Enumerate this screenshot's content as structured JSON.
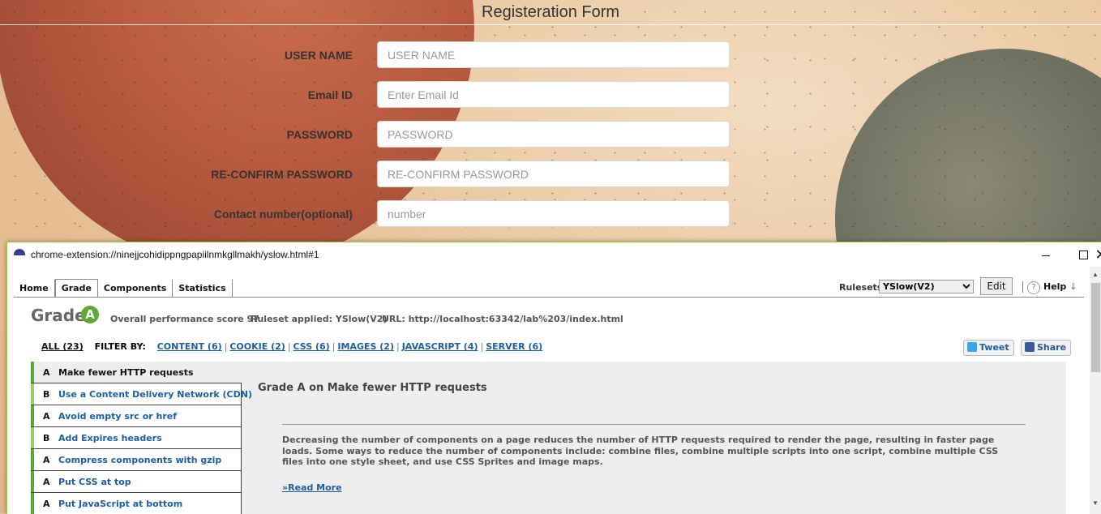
{
  "form": {
    "title": "Registeration Form",
    "fields": [
      {
        "label": "USER NAME",
        "placeholder": "USER NAME"
      },
      {
        "label": "Email ID",
        "placeholder": "Enter Email Id"
      },
      {
        "label": "PASSWORD",
        "placeholder": "PASSWORD"
      },
      {
        "label": "RE-CONFIRM PASSWORD",
        "placeholder": "RE-CONFIRM PASSWORD"
      },
      {
        "label": "Contact number(optional)",
        "placeholder": "number"
      }
    ]
  },
  "popup": {
    "url": "chrome-extension://ninejjcohidippngpapiilnmkgllmakh/yslow.html#1",
    "tabs": [
      "Home",
      "Grade",
      "Components",
      "Statistics"
    ],
    "active_tab": "Grade",
    "rulesets_label": "Rulesets",
    "ruleset_selected": "YSlow(V2)",
    "edit_label": "Edit",
    "help_label": "Help",
    "help_arrow": "↓",
    "grade_word": "Grade",
    "grade_letter": "A",
    "score_text": "Overall performance score 97",
    "ruleset_text": "Ruleset applied: YSlow(V2)",
    "url_text": "URL: http://localhost:63342/lab%203/index.html",
    "filter": {
      "all": "ALL (23)",
      "label": "FILTER BY:",
      "items": [
        "CONTENT (6)",
        "COOKIE (2)",
        "CSS (6)",
        "IMAGES (2)",
        "JAVASCRIPT (4)",
        "SERVER (6)"
      ]
    },
    "tweet_label": "Tweet",
    "share_label": "Share",
    "rules": [
      {
        "grade": "A",
        "name": "Make fewer HTTP requests"
      },
      {
        "grade": "B",
        "name": "Use a Content Delivery Network (CDN)"
      },
      {
        "grade": "A",
        "name": "Avoid empty src or href"
      },
      {
        "grade": "B",
        "name": "Add Expires headers"
      },
      {
        "grade": "A",
        "name": "Compress components with gzip"
      },
      {
        "grade": "A",
        "name": "Put CSS at top"
      },
      {
        "grade": "A",
        "name": "Put JavaScript at bottom"
      }
    ],
    "detail": {
      "title": "Grade A on Make fewer HTTP requests",
      "text": "Decreasing the number of components on a page reduces the number of HTTP requests required to render the page, resulting in faster page loads. Some ways to reduce the number of components include: combine files, combine multiple scripts into one script, combine multiple CSS files into one style sheet, and use CSS Sprites and image maps.",
      "read_more": "»Read More"
    }
  },
  "colors": {
    "grade_a": "#5ea837",
    "grade_b": "#9acf6b",
    "link": "#1d5fa0",
    "window_border": "#9bc23c"
  }
}
